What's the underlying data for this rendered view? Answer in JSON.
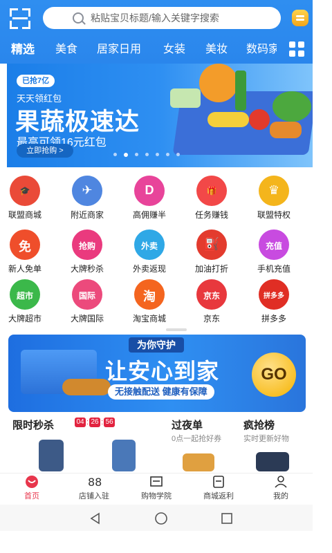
{
  "header": {
    "search_placeholder": "粘贴宝贝标题/输入关键字搜索",
    "tabs": [
      "精选",
      "美食",
      "居家日用",
      "女装",
      "美妆",
      "数码家"
    ]
  },
  "banner": {
    "tag": "已抢7亿",
    "sub": "天天领红包",
    "title": "果蔬极速达",
    "desc": "最高可领16元红包",
    "cta": "立即抢购 >",
    "dots": 7,
    "active_dot": 1
  },
  "categories": [
    {
      "label": "联盟商城",
      "icon": "graduation-cap-icon",
      "color": "#ea4a38",
      "glyph": "🎓"
    },
    {
      "label": "附近商家",
      "icon": "plane-icon",
      "color": "#4f86e0",
      "glyph": "✈"
    },
    {
      "label": "高佣赚半",
      "icon": "d-coin-icon",
      "color": "#e8449a",
      "glyph": "D"
    },
    {
      "label": "任务赚钱",
      "icon": "gift-icon",
      "color": "#f24848",
      "glyph": "🎁"
    },
    {
      "label": "联盟特权",
      "icon": "crown-icon",
      "color": "#f4b51c",
      "glyph": "♛"
    },
    {
      "label": "新人免单",
      "icon": "gift-box-icon",
      "color": "#ef4e2b",
      "glyph": "免"
    },
    {
      "label": "大牌秒杀",
      "icon": "sale-tag-icon",
      "color": "#ea3a7e",
      "glyph": "抢购"
    },
    {
      "label": "外卖返现",
      "icon": "takeaway-icon",
      "color": "#2fa8e6",
      "glyph": "外卖"
    },
    {
      "label": "加油打折",
      "icon": "fuel-pump-icon",
      "color": "#e33b2e",
      "glyph": "⛽"
    },
    {
      "label": "手机充值",
      "icon": "phone-topup-icon",
      "color": "#c84be0",
      "glyph": "充值"
    },
    {
      "label": "大牌超市",
      "icon": "supermarket-icon",
      "color": "#3bb84a",
      "glyph": "超市"
    },
    {
      "label": "大牌国际",
      "icon": "international-icon",
      "color": "#ec4a7c",
      "glyph": "国际"
    },
    {
      "label": "淘宝商城",
      "icon": "taobao-icon",
      "color": "#f4651f",
      "glyph": "淘"
    },
    {
      "label": "京东",
      "icon": "jd-icon",
      "color": "#e8383d",
      "glyph": "京东"
    },
    {
      "label": "拼多多",
      "icon": "pinduoduo-icon",
      "color": "#e02e24",
      "glyph": "拼多多"
    }
  ],
  "promo": {
    "top": "为你守护",
    "big": "让安心到家",
    "line": "无接触配送 健康有保障",
    "go": "GO"
  },
  "sections": {
    "flash_title": "限时秒杀",
    "timer": [
      "04",
      "26",
      "56"
    ],
    "overnight_title": "过夜单",
    "overnight_sub": "0点一起抢好券",
    "rank_title": "疯抢榜",
    "rank_sub": "实时更新好物"
  },
  "nav": [
    {
      "label": "首页",
      "icon": "home-icon",
      "active": true
    },
    {
      "label": "店铺入驻",
      "icon": "shop-icon",
      "active": false
    },
    {
      "label": "购物学院",
      "icon": "school-icon",
      "active": false
    },
    {
      "label": "商城返利",
      "icon": "rebate-icon",
      "active": false
    },
    {
      "label": "我的",
      "icon": "profile-icon",
      "active": false
    }
  ],
  "colors": {
    "header_blue": "#2f8ef0",
    "accent_red": "#e8364c"
  }
}
